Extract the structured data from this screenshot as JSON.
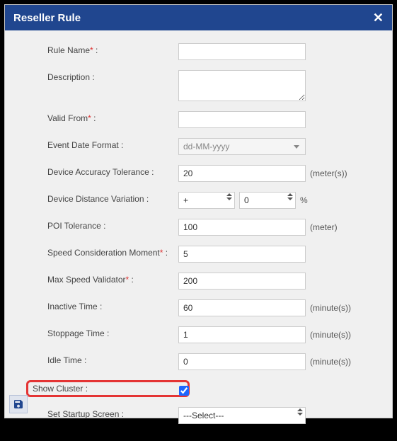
{
  "header": {
    "title": "Reseller Rule",
    "close": "✕"
  },
  "form": {
    "ruleName": {
      "label": "Rule Name",
      "required": true,
      "value": ""
    },
    "description": {
      "label": "Description :",
      "value": ""
    },
    "validFrom": {
      "label": "Valid From",
      "required": true,
      "value": ""
    },
    "eventDateFormat": {
      "label": "Event Date Format :",
      "selected": "dd-MM-yyyy"
    },
    "deviceAccuracy": {
      "label": "Device Accuracy Tolerance :",
      "value": "20",
      "unit": "(meter(s))"
    },
    "deviceDistance": {
      "label": "Device Distance Variation :",
      "op": "+",
      "value": "0",
      "unit": "%"
    },
    "poiTolerance": {
      "label": "POI Tolerance :",
      "value": "100",
      "unit": "(meter)"
    },
    "speedMoment": {
      "label": "Speed Consideration Moment",
      "required": true,
      "value": "5"
    },
    "maxSpeed": {
      "label": "Max Speed Validator",
      "required": true,
      "value": "200"
    },
    "inactiveTime": {
      "label": "Inactive Time :",
      "value": "60",
      "unit": "(minute(s))"
    },
    "stoppageTime": {
      "label": "Stoppage Time :",
      "value": "1",
      "unit": "(minute(s))"
    },
    "idleTime": {
      "label": "Idle Time :",
      "value": "0",
      "unit": "(minute(s))"
    },
    "showCluster": {
      "label": "Show Cluster :",
      "checked": true
    },
    "startupScreen": {
      "label": "Set Startup Screen :",
      "selected": "---Select---"
    }
  }
}
